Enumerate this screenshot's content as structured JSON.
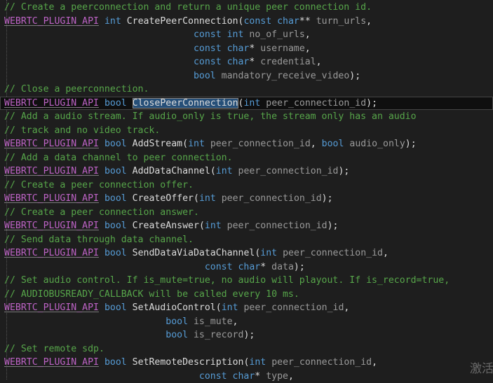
{
  "colors": {
    "background": "#1e1e1e",
    "comment": "#57a64a",
    "macro": "#bd63c5",
    "keyword": "#569cd6",
    "identifier": "#dcdcdc",
    "parameter": "#9a9a9a",
    "selection": "#264f78"
  },
  "lines": [
    [
      {
        "t": "comment",
        "v": "// Create a peerconnection and return a unique peer connection id."
      }
    ],
    [
      {
        "t": "macro",
        "v": "WEBRTC_PLUGIN_API"
      },
      {
        "t": "punct",
        "v": " "
      },
      {
        "t": "kw",
        "v": "int"
      },
      {
        "t": "punct",
        "v": " "
      },
      {
        "t": "func",
        "v": "CreatePeerConnection"
      },
      {
        "t": "punct",
        "v": "("
      },
      {
        "t": "kw",
        "v": "const char"
      },
      {
        "t": "punct",
        "v": "** "
      },
      {
        "t": "param",
        "v": "turn_urls"
      },
      {
        "t": "punct",
        "v": ","
      }
    ],
    [
      {
        "t": "punct",
        "v": "                                  "
      },
      {
        "t": "kw",
        "v": "const int"
      },
      {
        "t": "punct",
        "v": " "
      },
      {
        "t": "param",
        "v": "no_of_urls"
      },
      {
        "t": "punct",
        "v": ","
      }
    ],
    [
      {
        "t": "punct",
        "v": "                                  "
      },
      {
        "t": "kw",
        "v": "const char"
      },
      {
        "t": "punct",
        "v": "* "
      },
      {
        "t": "param",
        "v": "username"
      },
      {
        "t": "punct",
        "v": ","
      }
    ],
    [
      {
        "t": "punct",
        "v": "                                  "
      },
      {
        "t": "kw",
        "v": "const char"
      },
      {
        "t": "punct",
        "v": "* "
      },
      {
        "t": "param",
        "v": "credential"
      },
      {
        "t": "punct",
        "v": ","
      }
    ],
    [
      {
        "t": "punct",
        "v": "                                  "
      },
      {
        "t": "kw",
        "v": "bool"
      },
      {
        "t": "punct",
        "v": " "
      },
      {
        "t": "param",
        "v": "mandatory_receive_video"
      },
      {
        "t": "punct",
        "v": ");"
      }
    ],
    [
      {
        "t": "comment",
        "v": "// Close a peerconnection."
      }
    ],
    [
      {
        "t": "macro",
        "v": "WEBRTC_PLUGIN_API"
      },
      {
        "t": "punct",
        "v": " "
      },
      {
        "t": "kw",
        "v": "bool"
      },
      {
        "t": "punct",
        "v": " "
      },
      {
        "t": "sel",
        "v": "ClosePeerConnection"
      },
      {
        "t": "punct",
        "v": "("
      },
      {
        "t": "kw",
        "v": "int"
      },
      {
        "t": "punct",
        "v": " "
      },
      {
        "t": "param",
        "v": "peer_connection_id"
      },
      {
        "t": "punct",
        "v": ");"
      }
    ],
    [
      {
        "t": "comment",
        "v": "// Add a audio stream. If audio_only is true, the stream only has an audio"
      }
    ],
    [
      {
        "t": "comment",
        "v": "// track and no video track."
      }
    ],
    [
      {
        "t": "macro",
        "v": "WEBRTC_PLUGIN_API"
      },
      {
        "t": "punct",
        "v": " "
      },
      {
        "t": "kw",
        "v": "bool"
      },
      {
        "t": "punct",
        "v": " "
      },
      {
        "t": "func",
        "v": "AddStream"
      },
      {
        "t": "punct",
        "v": "("
      },
      {
        "t": "kw",
        "v": "int"
      },
      {
        "t": "punct",
        "v": " "
      },
      {
        "t": "param",
        "v": "peer_connection_id"
      },
      {
        "t": "punct",
        "v": ", "
      },
      {
        "t": "kw",
        "v": "bool"
      },
      {
        "t": "punct",
        "v": " "
      },
      {
        "t": "param",
        "v": "audio_only"
      },
      {
        "t": "punct",
        "v": ");"
      }
    ],
    [
      {
        "t": "comment",
        "v": "// Add a data channel to peer connection."
      }
    ],
    [
      {
        "t": "macro",
        "v": "WEBRTC_PLUGIN_API"
      },
      {
        "t": "punct",
        "v": " "
      },
      {
        "t": "kw",
        "v": "bool"
      },
      {
        "t": "punct",
        "v": " "
      },
      {
        "t": "func",
        "v": "AddDataChannel"
      },
      {
        "t": "punct",
        "v": "("
      },
      {
        "t": "kw",
        "v": "int"
      },
      {
        "t": "punct",
        "v": " "
      },
      {
        "t": "param",
        "v": "peer_connection_id"
      },
      {
        "t": "punct",
        "v": ");"
      }
    ],
    [
      {
        "t": "comment",
        "v": "// Create a peer connection offer."
      }
    ],
    [
      {
        "t": "macro",
        "v": "WEBRTC_PLUGIN_API"
      },
      {
        "t": "punct",
        "v": " "
      },
      {
        "t": "kw",
        "v": "bool"
      },
      {
        "t": "punct",
        "v": " "
      },
      {
        "t": "func",
        "v": "CreateOffer"
      },
      {
        "t": "punct",
        "v": "("
      },
      {
        "t": "kw",
        "v": "int"
      },
      {
        "t": "punct",
        "v": " "
      },
      {
        "t": "param",
        "v": "peer_connection_id"
      },
      {
        "t": "punct",
        "v": ");"
      }
    ],
    [
      {
        "t": "comment",
        "v": "// Create a peer connection answer."
      }
    ],
    [
      {
        "t": "macro",
        "v": "WEBRTC_PLUGIN_API"
      },
      {
        "t": "punct",
        "v": " "
      },
      {
        "t": "kw",
        "v": "bool"
      },
      {
        "t": "punct",
        "v": " "
      },
      {
        "t": "func",
        "v": "CreateAnswer"
      },
      {
        "t": "punct",
        "v": "("
      },
      {
        "t": "kw",
        "v": "int"
      },
      {
        "t": "punct",
        "v": " "
      },
      {
        "t": "param",
        "v": "peer_connection_id"
      },
      {
        "t": "punct",
        "v": ");"
      }
    ],
    [
      {
        "t": "comment",
        "v": "// Send data through data channel."
      }
    ],
    [
      {
        "t": "macro",
        "v": "WEBRTC_PLUGIN_API"
      },
      {
        "t": "punct",
        "v": " "
      },
      {
        "t": "kw",
        "v": "bool"
      },
      {
        "t": "punct",
        "v": " "
      },
      {
        "t": "func",
        "v": "SendDataViaDataChannel"
      },
      {
        "t": "punct",
        "v": "("
      },
      {
        "t": "kw",
        "v": "int"
      },
      {
        "t": "punct",
        "v": " "
      },
      {
        "t": "param",
        "v": "peer_connection_id"
      },
      {
        "t": "punct",
        "v": ","
      }
    ],
    [
      {
        "t": "punct",
        "v": "                                    "
      },
      {
        "t": "kw",
        "v": "const char"
      },
      {
        "t": "punct",
        "v": "* "
      },
      {
        "t": "param",
        "v": "data"
      },
      {
        "t": "punct",
        "v": ");"
      }
    ],
    [
      {
        "t": "comment",
        "v": "// Set audio control. If is_mute=true, no audio will playout. If is_record=true,"
      }
    ],
    [
      {
        "t": "comment",
        "v": "// AUDIOBUSREADY_CALLBACK will be called every 10 ms."
      }
    ],
    [
      {
        "t": "macro",
        "v": "WEBRTC_PLUGIN_API"
      },
      {
        "t": "punct",
        "v": " "
      },
      {
        "t": "kw",
        "v": "bool"
      },
      {
        "t": "punct",
        "v": " "
      },
      {
        "t": "func",
        "v": "SetAudioControl"
      },
      {
        "t": "punct",
        "v": "("
      },
      {
        "t": "kw",
        "v": "int"
      },
      {
        "t": "punct",
        "v": " "
      },
      {
        "t": "param",
        "v": "peer_connection_id"
      },
      {
        "t": "punct",
        "v": ","
      }
    ],
    [
      {
        "t": "punct",
        "v": "                             "
      },
      {
        "t": "kw",
        "v": "bool"
      },
      {
        "t": "punct",
        "v": " "
      },
      {
        "t": "param",
        "v": "is_mute"
      },
      {
        "t": "punct",
        "v": ","
      }
    ],
    [
      {
        "t": "punct",
        "v": "                             "
      },
      {
        "t": "kw",
        "v": "bool"
      },
      {
        "t": "punct",
        "v": " "
      },
      {
        "t": "param",
        "v": "is_record"
      },
      {
        "t": "punct",
        "v": ");"
      }
    ],
    [
      {
        "t": "comment",
        "v": "// Set remote sdp."
      }
    ],
    [
      {
        "t": "macro",
        "v": "WEBRTC_PLUGIN_API"
      },
      {
        "t": "punct",
        "v": " "
      },
      {
        "t": "kw",
        "v": "bool"
      },
      {
        "t": "punct",
        "v": " "
      },
      {
        "t": "func",
        "v": "SetRemoteDescription"
      },
      {
        "t": "punct",
        "v": "("
      },
      {
        "t": "kw",
        "v": "int"
      },
      {
        "t": "punct",
        "v": " "
      },
      {
        "t": "param",
        "v": "peer_connection_id"
      },
      {
        "t": "punct",
        "v": ","
      }
    ],
    [
      {
        "t": "punct",
        "v": "                                   "
      },
      {
        "t": "kw",
        "v": "const char"
      },
      {
        "t": "punct",
        "v": "* "
      },
      {
        "t": "param",
        "v": "type"
      },
      {
        "t": "punct",
        "v": ","
      }
    ]
  ],
  "current_line": 7,
  "watermark": "激活"
}
